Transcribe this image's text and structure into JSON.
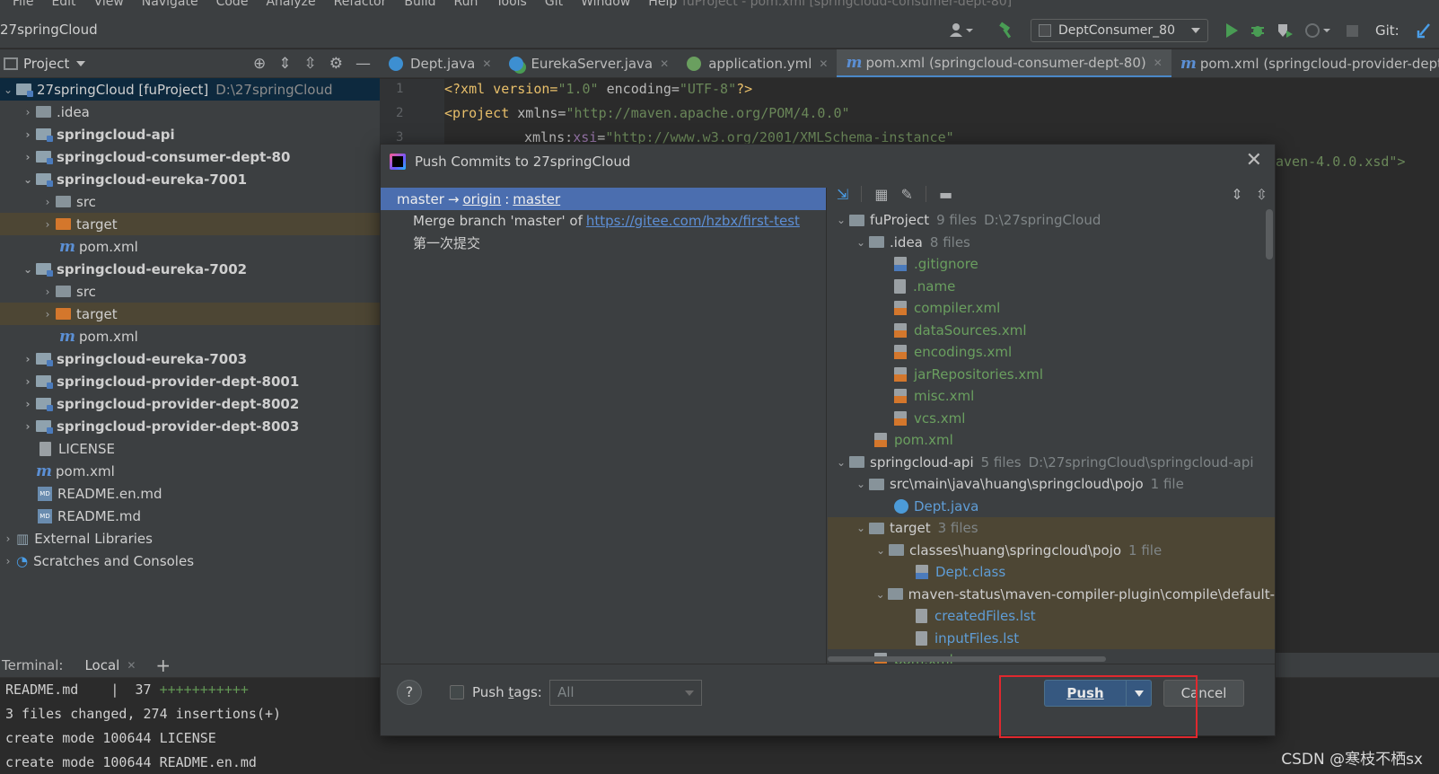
{
  "menu": [
    "File",
    "Edit",
    "View",
    "Navigate",
    "Code",
    "Analyze",
    "Refactor",
    "Build",
    "Run",
    "Tools",
    "Git",
    "Window",
    "Help"
  ],
  "window_title": "fuProject - pom.xml [springcloud-consumer-dept-80]",
  "breadcrumb": "27springCloud",
  "run_config": "DeptConsumer_80",
  "git_label": "Git:",
  "project_panel": {
    "title": "Project",
    "tree": [
      {
        "label": "27springCloud [fuProject]",
        "path": "D:\\27springCloud",
        "expanded": true
      },
      {
        "label": ".idea"
      },
      {
        "label": "springcloud-api"
      },
      {
        "label": "springcloud-consumer-dept-80"
      },
      {
        "label": "springcloud-eureka-7001"
      },
      {
        "label": "src"
      },
      {
        "label": "target"
      },
      {
        "label": "pom.xml"
      },
      {
        "label": "springcloud-eureka-7002"
      },
      {
        "label": "src"
      },
      {
        "label": "target"
      },
      {
        "label": "pom.xml"
      },
      {
        "label": "springcloud-eureka-7003"
      },
      {
        "label": "springcloud-provider-dept-8001"
      },
      {
        "label": "springcloud-provider-dept-8002"
      },
      {
        "label": "springcloud-provider-dept-8003"
      },
      {
        "label": "LICENSE"
      },
      {
        "label": "pom.xml"
      },
      {
        "label": "README.en.md"
      },
      {
        "label": "README.md"
      },
      {
        "label": "External Libraries"
      },
      {
        "label": "Scratches and Consoles"
      }
    ]
  },
  "editor_tabs": [
    {
      "label": "Dept.java",
      "icon": "class-icon"
    },
    {
      "label": "EurekaServer.java",
      "icon": "spring-class-icon"
    },
    {
      "label": "application.yml",
      "icon": "yaml-icon"
    },
    {
      "label": "pom.xml (springcloud-consumer-dept-80)",
      "icon": "maven-icon",
      "active": true
    },
    {
      "label": "pom.xml (springcloud-provider-dept-"
    }
  ],
  "editor": {
    "lines": [
      "1",
      "2",
      "3"
    ],
    "code": {
      "l1_a": "<?xml version=",
      "l1_b": "\"1.0\"",
      "l1_c": " encoding=",
      "l1_d": "\"UTF-8\"",
      "l1_e": "?>",
      "l2_a": "<project ",
      "l2_b": "xmlns=",
      "l2_c": "\"http://maven.apache.org/POM/4.0.0\"",
      "l3_a": "xmlns:",
      "l3_b": "xsi",
      "l3_c": "=",
      "l3_d": "\"http://www.w3.org/2001/XMLSchema-instance\"",
      "l4": "aven-4.0.0.xsd\">"
    }
  },
  "dialog": {
    "title": "Push Commits to 27springCloud",
    "branch": {
      "local": "master",
      "arrow": "→",
      "remote": "origin",
      "sep": ":",
      "remote_branch": "master"
    },
    "commits": [
      {
        "text": "Merge branch 'master' of",
        "link": "https://gitee.com/hzbx/first-test"
      },
      {
        "text": "第一次提交"
      }
    ],
    "changes": [
      {
        "label": "fuProject",
        "count": "9 files",
        "path": "D:\\27springCloud"
      },
      {
        "label": ".idea",
        "count": "8 files"
      },
      {
        "label": ".gitignore"
      },
      {
        "label": ".name"
      },
      {
        "label": "compiler.xml"
      },
      {
        "label": "dataSources.xml"
      },
      {
        "label": "encodings.xml"
      },
      {
        "label": "jarRepositories.xml"
      },
      {
        "label": "misc.xml"
      },
      {
        "label": "vcs.xml"
      },
      {
        "label": "pom.xml"
      },
      {
        "label": "springcloud-api",
        "count": "5 files",
        "path": "D:\\27springCloud\\springcloud-api"
      },
      {
        "label": "src\\main\\java\\huang\\springcloud\\pojo",
        "count": "1 file"
      },
      {
        "label": "Dept.java"
      },
      {
        "label": "target",
        "count": "3 files"
      },
      {
        "label": "classes\\huang\\springcloud\\pojo",
        "count": "1 file"
      },
      {
        "label": "Dept.class"
      },
      {
        "label": "maven-status\\maven-compiler-plugin\\compile\\default-"
      },
      {
        "label": "createdFiles.lst"
      },
      {
        "label": "inputFiles.lst"
      },
      {
        "label": "pom.xml"
      }
    ],
    "push_tags_label_pre": "Push ",
    "push_tags_label_u": "t",
    "push_tags_label_post": "ags:",
    "push_tags_value": "All",
    "push_button": "Push",
    "cancel_button": "Cancel",
    "help": "?"
  },
  "terminal": {
    "label": "Terminal:",
    "tab": "Local",
    "lines": [
      {
        "text": "README.md    |  37 ",
        "plus": "+++++++++++"
      },
      {
        "text": "3 files changed, 274 insertions(+)"
      },
      {
        "text": "create mode 100644 LICENSE"
      },
      {
        "text": "create mode 100644 README.en.md"
      }
    ]
  },
  "watermark": "CSDN @寒枝不栖sx"
}
